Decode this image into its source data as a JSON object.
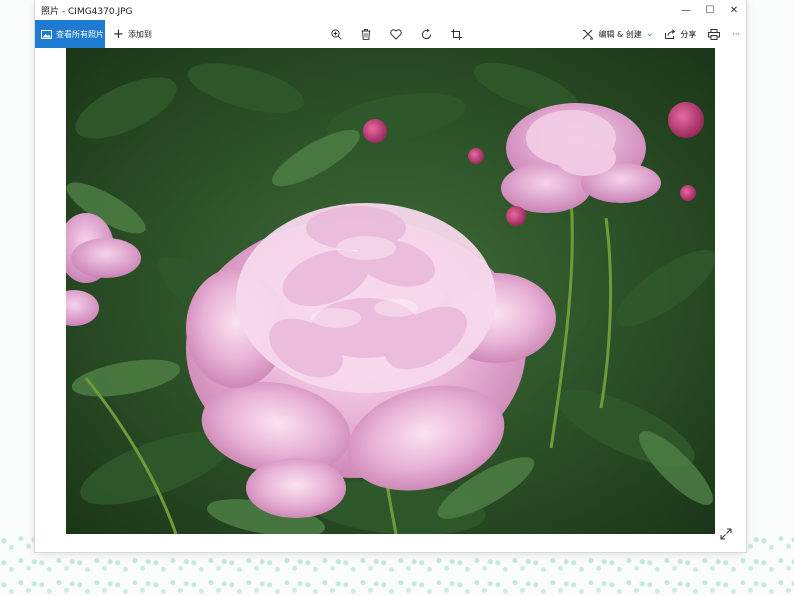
{
  "window": {
    "app_name": "照片",
    "separator": " - ",
    "file_name": "CIMG4370.JPG",
    "controls": {
      "minimize": "—",
      "maximize": "☐",
      "close": "✕"
    }
  },
  "toolbar": {
    "view_all_label": "查看所有照片",
    "add_to_label": "添加到",
    "edit_create_label": "编辑 & 创建",
    "share_label": "分享",
    "more_label": "···"
  },
  "icons": {
    "zoom": "zoom-in-icon",
    "delete": "trash-icon",
    "favorite": "heart-icon",
    "rotate": "rotate-icon",
    "crop": "crop-icon",
    "print": "printer-icon",
    "expand": "expand-icon"
  },
  "colors": {
    "accent": "#1f7bd1"
  },
  "photo": {
    "subject": "pink peony flowers with green foliage"
  }
}
